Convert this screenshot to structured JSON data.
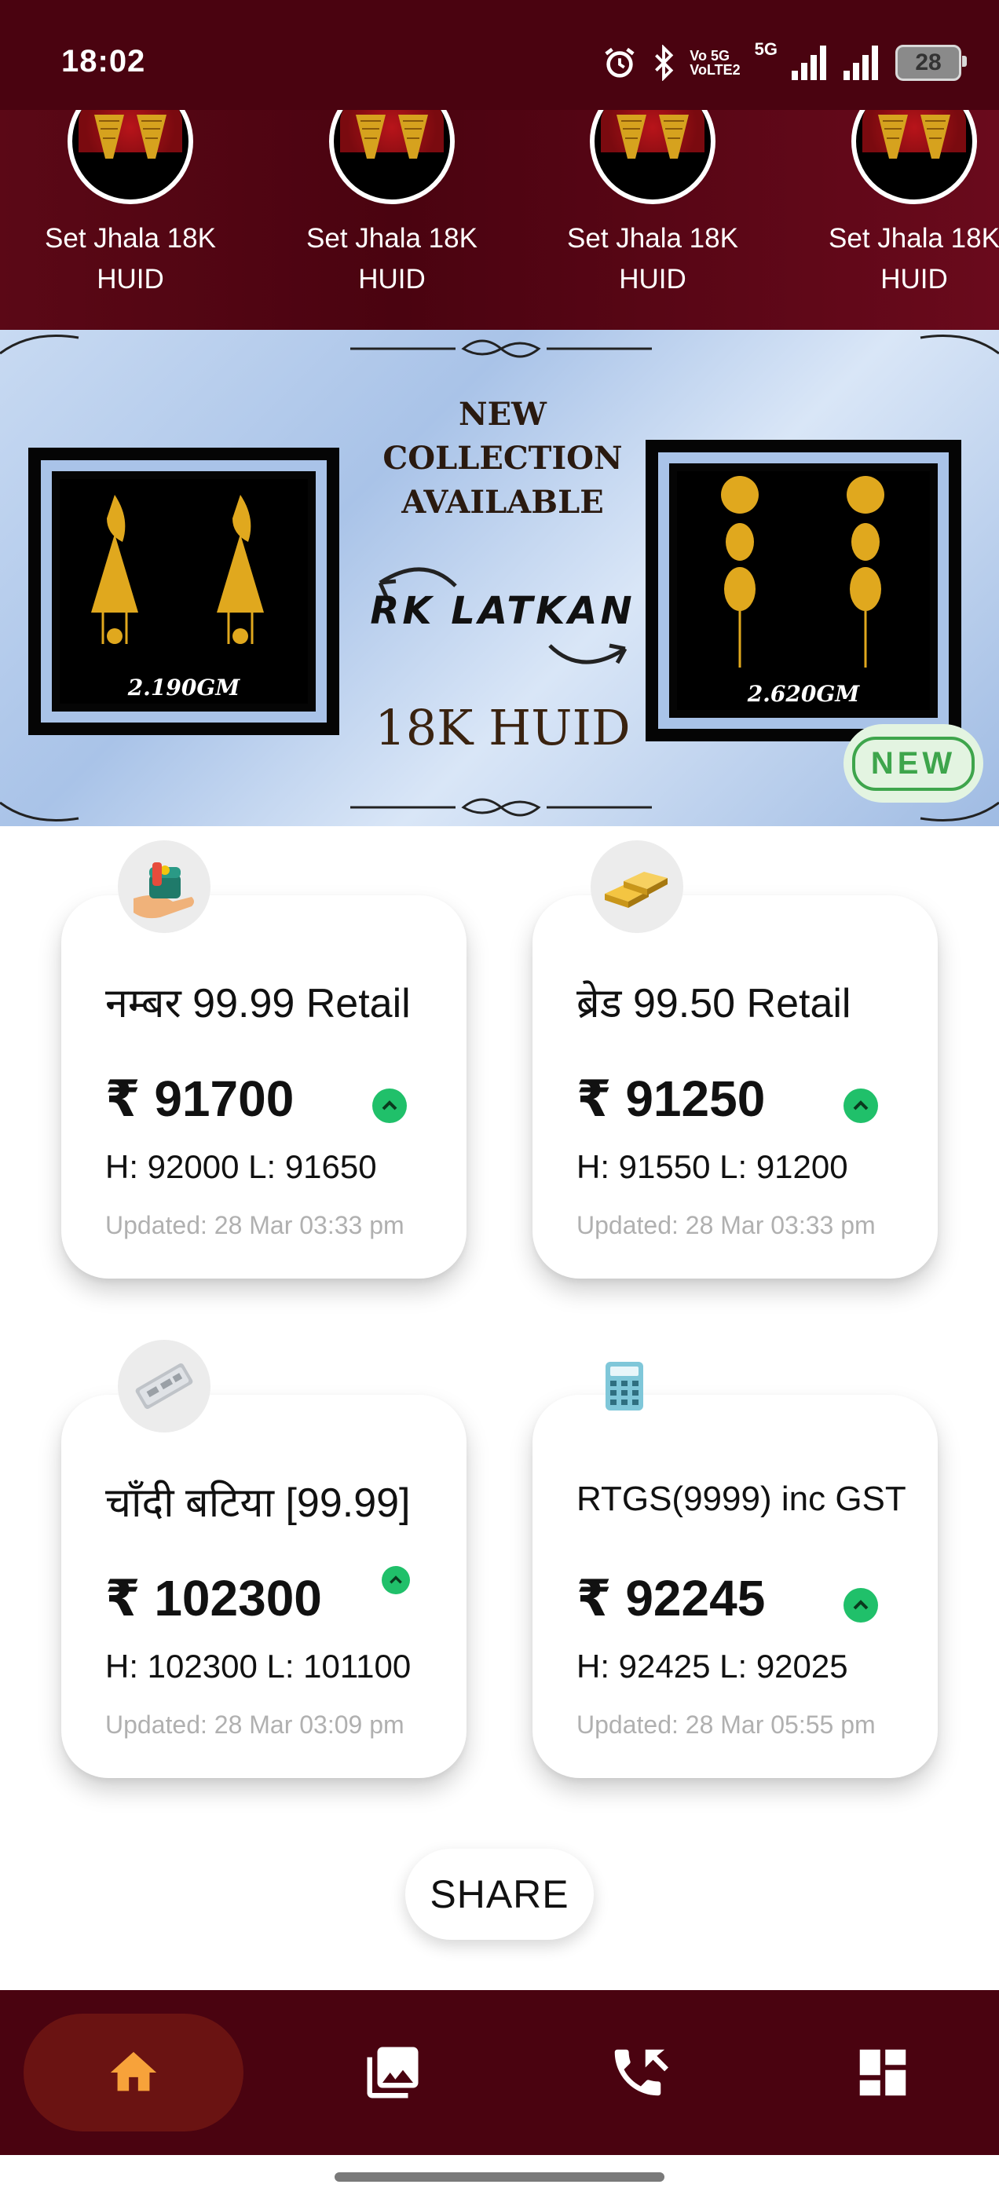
{
  "status_bar": {
    "time": "18:02",
    "network_1_top": "Vo 5G",
    "network_1_bottom": "VoLTE2",
    "network_2": "5G",
    "battery": "28",
    "icons": [
      "alarm-icon",
      "bluetooth-icon",
      "signal-icon",
      "battery-icon"
    ]
  },
  "categories": [
    {
      "label": "Set Jhala 18K HUID"
    },
    {
      "label": "Set Jhala 18K HUID"
    },
    {
      "label": "Set Jhala 18K HUID"
    },
    {
      "label": "Set Jhala 18K HUID"
    }
  ],
  "banner": {
    "heading_line1": "NEW",
    "heading_line2": "COLLECTION",
    "heading_line3": "AVAILABLE",
    "brand": "RK LATKAN",
    "purity": "18K HUID",
    "left_weight": "2.190GM",
    "right_weight": "2.620GM",
    "badge": "NEW"
  },
  "rates": [
    {
      "title": "नम्बर 99.99 Retail",
      "price": "₹ 91700",
      "hl": "H: 92000  L: 91650",
      "updated": "Updated: 28 Mar 03:33 pm",
      "icon": "jewellery-box-icon",
      "trend": "up"
    },
    {
      "title": "ब्रेड 99.50 Retail",
      "price": "₹ 91250",
      "hl": "H: 91550  L: 91200",
      "updated": "Updated: 28 Mar 03:33 pm",
      "icon": "gold-bars-icon",
      "trend": "up"
    },
    {
      "title": "चाँदी बटिया [99.99]",
      "price": "₹ 102300",
      "hl": "H: 102300  L: 101100",
      "updated": "Updated: 28 Mar 03:09 pm",
      "icon": "silver-bar-icon",
      "trend": "up"
    },
    {
      "title": "RTGS(9999) inc GST",
      "price": "₹ 92245",
      "hl": "H: 92425  L: 92025",
      "updated": "Updated: 28 Mar 05:55 pm",
      "icon": "calculator-icon",
      "trend": "up"
    }
  ],
  "share_label": "SHARE",
  "colors": {
    "brand_maroon": "#4a0310",
    "active_nav": "#6a1312",
    "active_icon": "#f7a23a",
    "trend_up": "#20c06a"
  },
  "nav": [
    {
      "icon": "home-icon",
      "active": true
    },
    {
      "icon": "gallery-icon",
      "active": false
    },
    {
      "icon": "contact-phone-icon",
      "active": false
    },
    {
      "icon": "dashboard-icon",
      "active": false
    }
  ]
}
